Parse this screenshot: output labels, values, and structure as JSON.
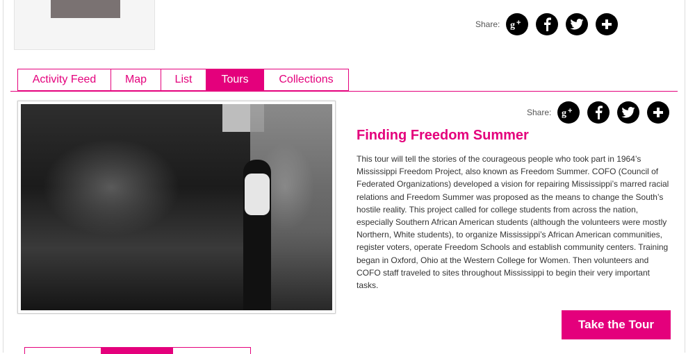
{
  "profile": {
    "avatar_icon": "user-avatar-placeholder"
  },
  "share_top": {
    "label": "Share:",
    "icons": [
      "google-plus-icon",
      "facebook-icon",
      "twitter-icon",
      "add-plus-icon"
    ]
  },
  "tabs": [
    {
      "label": "Activity Feed",
      "active": false
    },
    {
      "label": "Map",
      "active": false
    },
    {
      "label": "List",
      "active": false
    },
    {
      "label": "Tours",
      "active": true
    },
    {
      "label": "Collections",
      "active": false
    }
  ],
  "tour": {
    "share_label": "Share:",
    "title": "Finding Freedom Summer",
    "description": "This tour will tell the stories of the courageous people who took part in 1964’s Mississippi Freedom Project, also known as Freedom Summer. COFO (Council of Federated Organizations) developed a vision for repairing Mississippi’s marred racial relations and Freedom Summer was proposed as the means to change the South’s hostile reality. This project called for college students from across the nation, especially Southern African American students (although the volunteers were mostly Northern, White students), to organize Mississippi’s African American communities, register voters, operate Freedom Schools and establish community centers. Training began in Oxford, Ohio at the Western College for Women. Then volunteers and COFO staff traveled to sites throughout Mississippi to begin their very important tasks.",
    "cta_label": "Take the Tour",
    "image_icon": "tour-photo"
  },
  "colors": {
    "accent": "#e4007c",
    "text": "#333333",
    "icon_bg": "#000000"
  }
}
